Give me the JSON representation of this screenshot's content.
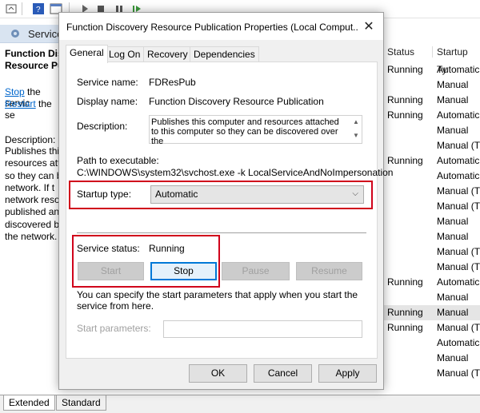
{
  "services_window": {
    "header_title": "Service",
    "selected_service_name": "Function Discovery Resource Publication",
    "stop_link": "Stop",
    "stop_suffix": " the servic",
    "restart_link": "Restart",
    "restart_suffix": " the se",
    "description_label": "Description:",
    "description_lines": [
      "Publishes this",
      "resources att",
      "so they can b",
      "network.  If t",
      "network reso",
      "published an",
      "discovered b",
      "the network."
    ],
    "columns": {
      "status": "Status",
      "startup_type": "Startup Ty"
    },
    "rows": [
      {
        "status": "Running",
        "startup": "Automatic"
      },
      {
        "status": "",
        "startup": "Manual"
      },
      {
        "status": "Running",
        "startup": "Manual"
      },
      {
        "status": "Running",
        "startup": "Automatic"
      },
      {
        "status": "",
        "startup": "Manual"
      },
      {
        "status": "",
        "startup": "Manual (Trig"
      },
      {
        "status": "Running",
        "startup": "Automatic"
      },
      {
        "status": "",
        "startup": "Automatic"
      },
      {
        "status": "",
        "startup": "Manual (Tr"
      },
      {
        "status": "",
        "startup": "Manual (Tr"
      },
      {
        "status": "",
        "startup": "Manual"
      },
      {
        "status": "",
        "startup": "Manual"
      },
      {
        "status": "",
        "startup": "Manual (Tr"
      },
      {
        "status": "",
        "startup": "Manual (Tr"
      },
      {
        "status": "Running",
        "startup": "Automatic"
      },
      {
        "status": "",
        "startup": "Manual"
      },
      {
        "status": "Running",
        "startup": "Manual"
      },
      {
        "status": "Running",
        "startup": "Manual (Tr"
      },
      {
        "status": "",
        "startup": "Automatic"
      },
      {
        "status": "",
        "startup": "Manual"
      },
      {
        "status": "",
        "startup": "Manual (Tr"
      }
    ],
    "selected_row_index": 16,
    "bottom_tabs": {
      "extended": "Extended",
      "standard": "Standard"
    }
  },
  "dialog": {
    "title": "Function Discovery Resource Publication Properties (Local Comput...",
    "tabs": [
      "General",
      "Log On",
      "Recovery",
      "Dependencies"
    ],
    "active_tab": "General",
    "service_name_label": "Service name:",
    "service_name_value": "FDResPub",
    "display_name_label": "Display name:",
    "display_name_value": "Function Discovery Resource Publication",
    "description_label": "Description:",
    "description_value": "Publishes this computer and resources attached to this computer so they can be discovered over the",
    "path_label": "Path to executable:",
    "path_value": "C:\\WINDOWS\\system32\\svchost.exe -k LocalServiceAndNoImpersonation",
    "startup_type_label": "Startup type:",
    "startup_type_value": "Automatic",
    "service_status_label": "Service status:",
    "service_status_value": "Running",
    "buttons": {
      "start": "Start",
      "stop": "Stop",
      "pause": "Pause",
      "resume": "Resume"
    },
    "hint_text": "You can specify the start parameters that apply when you start the service from here.",
    "start_params_label": "Start parameters:",
    "start_params_value": "",
    "footer": {
      "ok": "OK",
      "cancel": "Cancel",
      "apply": "Apply"
    }
  },
  "colors": {
    "highlight_red": "#d0021b",
    "focus_blue": "#0078d7",
    "link_blue": "#0066cc"
  }
}
